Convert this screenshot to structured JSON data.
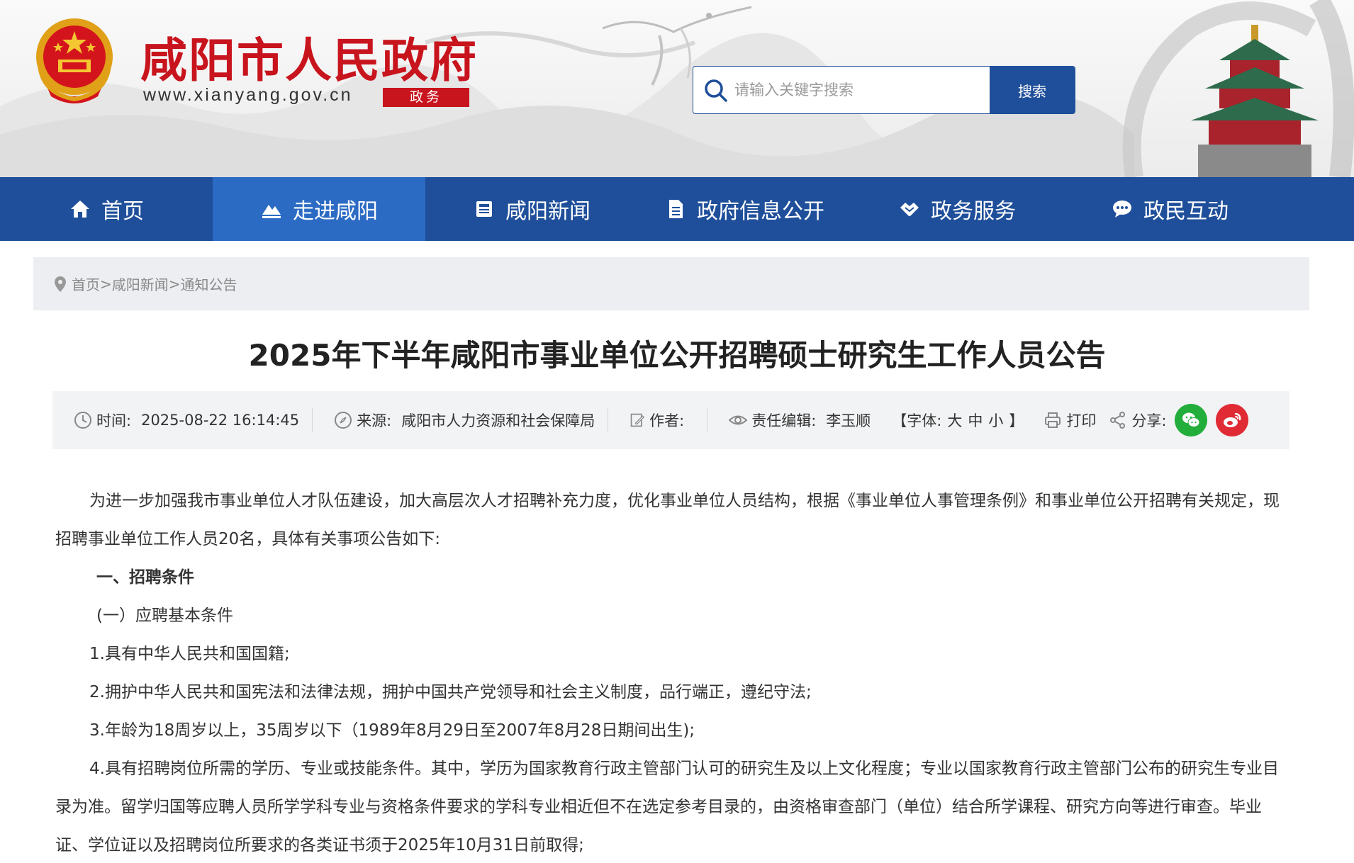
{
  "header": {
    "site_title": "咸阳市人民政府",
    "site_url": "www.xianyang.gov.cn",
    "site_tag": "政务",
    "search": {
      "placeholder": "请输入关键字搜索",
      "button_label": "搜索"
    }
  },
  "nav": {
    "items": [
      {
        "label": "首页",
        "icon": "home-icon"
      },
      {
        "label": "走进咸阳",
        "icon": "mountain-icon"
      },
      {
        "label": "咸阳新闻",
        "icon": "news-icon"
      },
      {
        "label": "政府信息公开",
        "icon": "document-icon"
      },
      {
        "label": "政务服务",
        "icon": "handshake-icon"
      },
      {
        "label": "政民互动",
        "icon": "chat-icon"
      }
    ],
    "active_index": 1
  },
  "breadcrumb": {
    "items": [
      "首页",
      "咸阳新闻",
      "通知公告"
    ],
    "separator": ">"
  },
  "article": {
    "title": "2025年下半年咸阳市事业单位公开招聘硕士研究生工作人员公告",
    "meta": {
      "time_label": "时间:",
      "time_value": "2025-08-22 16:14:45",
      "source_label": "来源:",
      "source_value": "咸阳市人力资源和社会保障局",
      "author_label": "作者:",
      "author_value": "",
      "editor_label": "责任编辑:",
      "editor_value": "李玉顺",
      "font_label_open": "【字体:",
      "font_large": "大",
      "font_medium": "中",
      "font_small": "小",
      "font_label_close": "】",
      "print_label": "打印",
      "share_label": "分享:"
    },
    "paragraphs": [
      "为进一步加强我市事业单位人才队伍建设，加大高层次人才招聘补充力度，优化事业单位人员结构，根据《事业单位人事管理条例》和事业单位公开招聘有关规定，现招聘事业单位工作人员20名，具体有关事项公告如下:",
      "一、招聘条件",
      "(一）应聘基本条件",
      "1.具有中华人民共和国国籍;",
      "2.拥护中华人民共和国宪法和法律法规，拥护中国共产党领导和社会主义制度，品行端正，遵纪守法;",
      "3.年龄为18周岁以上，35周岁以下（1989年8月29日至2007年8月28日期间出生);",
      "4.具有招聘岗位所需的学历、专业或技能条件。其中，学历为国家教育行政主管部门认可的研究生及以上文化程度；专业以国家教育行政主管部门公布的研究生专业目录为准。留学归国等应聘人员所学学科专业与资格条件要求的学科专业相近但不在选定参考目录的，由资格审查部门（单位）结合所学课程、研究方向等进行审查。毕业证、学位证以及招聘岗位所要求的各类证书须于2025年10月31日前取得;"
    ]
  },
  "colors": {
    "brand_red": "#c8141d",
    "nav_blue": "#1f4f9a",
    "nav_active": "#2c6bc4",
    "wechat_green": "#23ad3b",
    "weibo_red": "#e02b34"
  }
}
